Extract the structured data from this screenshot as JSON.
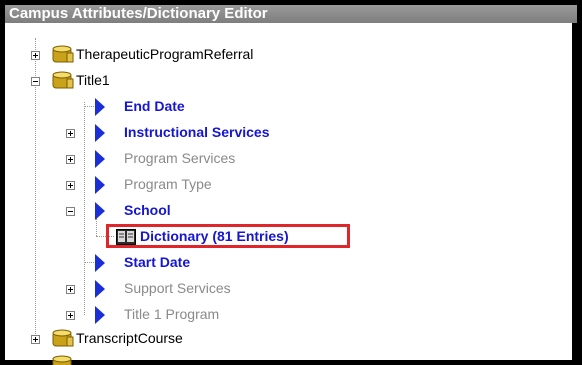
{
  "window": {
    "title": "Campus Attributes/Dictionary Editor"
  },
  "tree": {
    "therapeutic": "TherapeuticProgramReferral",
    "title1": "Title1",
    "end_date": "End Date",
    "instructional_services": "Instructional Services",
    "program_services": "Program Services",
    "program_type": "Program Type",
    "school": "School",
    "dictionary": "Dictionary (81 Entries)",
    "start_date": "Start Date",
    "support_services": "Support Services",
    "title1_program": "Title 1 Program",
    "transcript_course": "TranscriptCourse"
  },
  "colors": {
    "title_bar": "#8a8a8a",
    "link_blue": "#1515d4",
    "disabled_gray": "#8a8a8a",
    "highlight_red": "#e0252b"
  },
  "icons": {
    "folder": "folder-cylinder-icon",
    "field": "blue-arrow-icon",
    "dictionary": "dictionary-book-icon"
  }
}
